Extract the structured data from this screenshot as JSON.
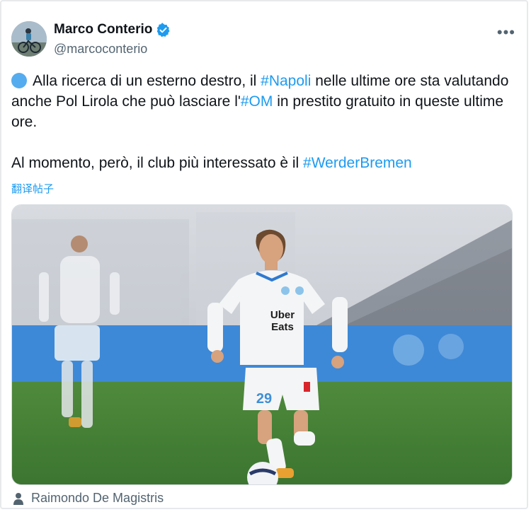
{
  "author": {
    "name": "Marco Conterio",
    "handle": "@marcoconterio"
  },
  "more_label": "•••",
  "tweet": {
    "para1": [
      {
        "type": "text",
        "text": "Alla ricerca di un esterno destro, il "
      },
      {
        "type": "hashtag",
        "text": "#Napoli"
      },
      {
        "type": "text",
        "text": " nelle ultime ore sta valutando anche Pol Lirola che può lasciare l'"
      },
      {
        "type": "hashtag",
        "text": "#OM"
      },
      {
        "type": "text",
        "text": " in prestito gratuito in queste ultime ore."
      }
    ],
    "para2": [
      {
        "type": "text",
        "text": "Al momento, però, il club più interessato è il "
      },
      {
        "type": "hashtag",
        "text": "#WerderBremen"
      }
    ]
  },
  "translate_label": "翻译帖子",
  "media": {
    "sponsor_line1": "Uber",
    "sponsor_line2": "Eats",
    "shirt_number": "29"
  },
  "photo_credit": "Raimondo De Magistris",
  "colors": {
    "hashtag": "#1d9bf0",
    "verified": "#1d9bf0",
    "muted": "#536471"
  }
}
